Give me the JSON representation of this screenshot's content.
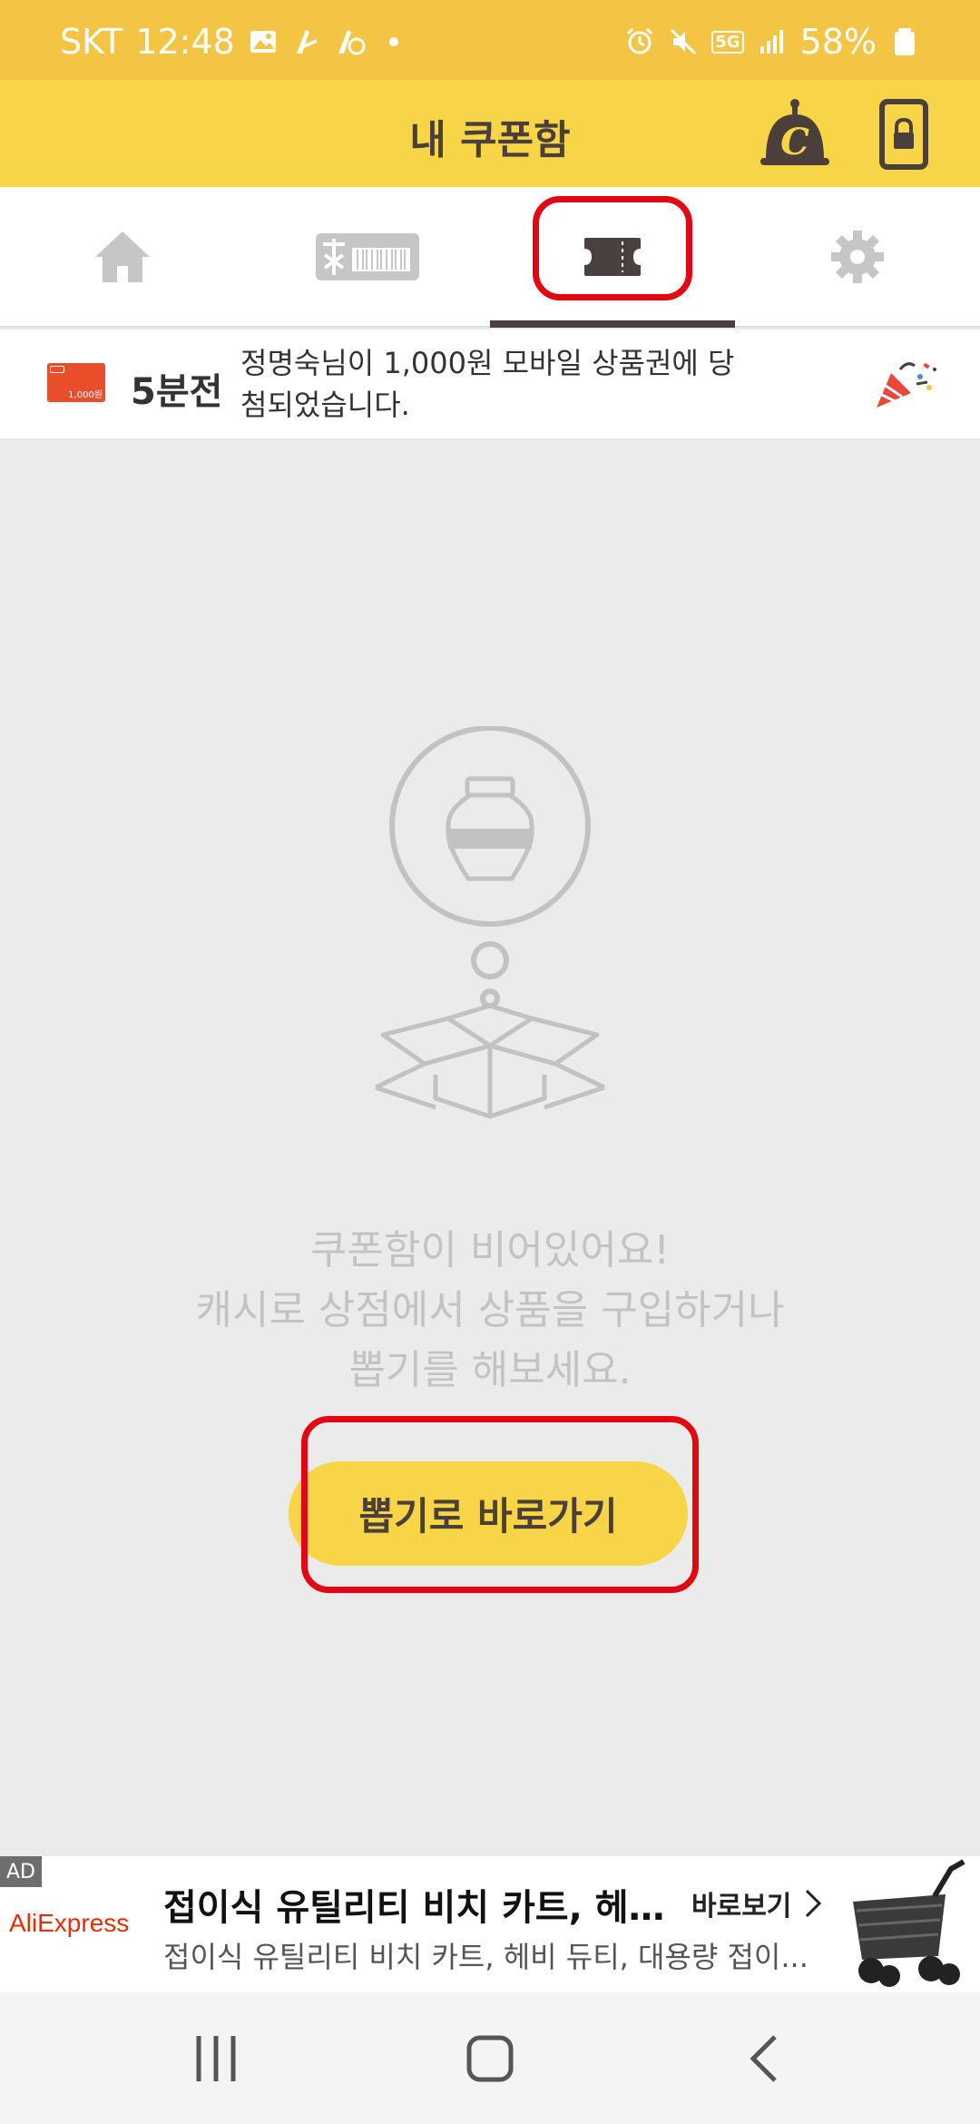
{
  "status_bar": {
    "carrier": "SKT",
    "time": "12:48",
    "network": "5G",
    "battery": "58%"
  },
  "header": {
    "title": "내 쿠폰함",
    "icons": [
      "cash-coin-icon",
      "lock-screen-icon"
    ]
  },
  "tabs": [
    {
      "name": "home",
      "icon": "home-icon",
      "active": false
    },
    {
      "name": "shop",
      "icon": "gift-card-icon",
      "active": false
    },
    {
      "name": "coupons",
      "icon": "ticket-icon",
      "active": true
    },
    {
      "name": "settings",
      "icon": "gear-icon",
      "active": false
    }
  ],
  "notice": {
    "time_ago": "5분전",
    "message": "정명숙님이 1,000원 모바일 상품권에 당첨되었습니다.",
    "card_amount": "1,000원"
  },
  "empty_state": {
    "line1": "쿠폰함이 비어있어요!",
    "line2": "캐시로 상점에서 상품을 구입하거나",
    "line3": "뽑기를 해보세요.",
    "button_label": "뽑기로 바로가기"
  },
  "ad": {
    "tag": "AD",
    "advertiser": "AliExpress",
    "title": "접이식 유틸리티 비치 카트, 헤비 ...",
    "subtitle": "접이식 유틸리티 비치 카트, 헤비 듀티, 대용량 접이...",
    "cta": "바로보기"
  },
  "colors": {
    "status_bar": "#f4c444",
    "header": "#f8d447",
    "highlight": "#e30613",
    "dark": "#4b4040"
  }
}
